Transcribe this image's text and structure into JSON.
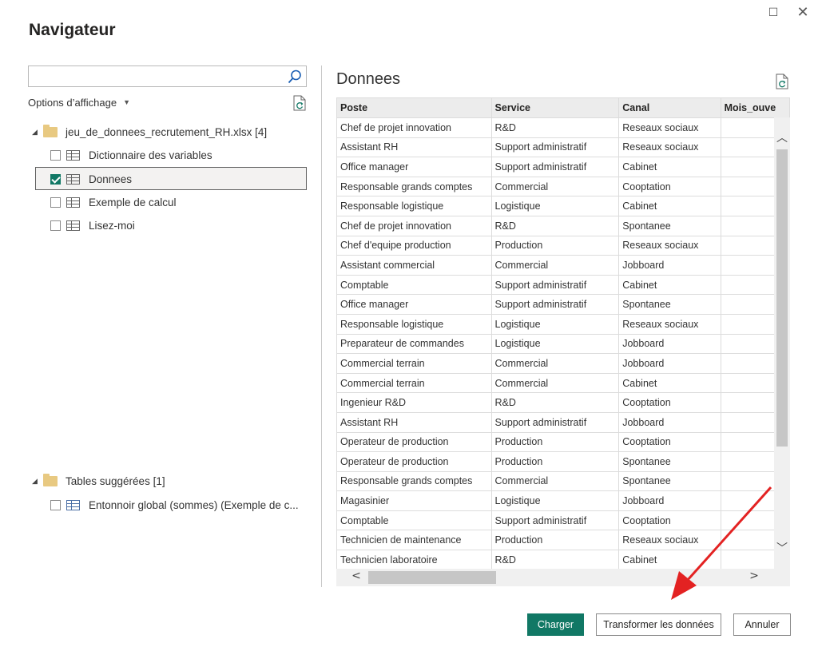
{
  "window": {
    "title": "Navigateur",
    "maximize_glyph": "☐",
    "close_glyph": "✕"
  },
  "left": {
    "search": {
      "value": "",
      "placeholder": "",
      "icon": "search-icon"
    },
    "options_label": "Options d’affichage",
    "file": {
      "name": "jeu_de_donnees_recrutement_RH.xlsx [4]"
    },
    "items": [
      {
        "label": "Dictionnaire des variables",
        "checked": false
      },
      {
        "label": "Donnees",
        "checked": true
      },
      {
        "label": "Exemple de calcul",
        "checked": false
      },
      {
        "label": "Lisez-moi",
        "checked": false
      }
    ],
    "suggested": {
      "label": "Tables suggérées [1]",
      "items": [
        {
          "label": "Entonnoir global (sommes) (Exemple de c...",
          "checked": false
        }
      ]
    }
  },
  "preview": {
    "title": "Donnees",
    "columns": [
      "Poste",
      "Service",
      "Canal",
      "Mois_ouve"
    ],
    "rows": [
      [
        "Chef de projet innovation",
        "R&D",
        "Reseaux sociaux",
        ""
      ],
      [
        "Assistant RH",
        "Support administratif",
        "Reseaux sociaux",
        ""
      ],
      [
        "Office manager",
        "Support administratif",
        "Cabinet",
        ""
      ],
      [
        "Responsable grands comptes",
        "Commercial",
        "Cooptation",
        ""
      ],
      [
        "Responsable logistique",
        "Logistique",
        "Cabinet",
        ""
      ],
      [
        "Chef de projet innovation",
        "R&D",
        "Spontanee",
        ""
      ],
      [
        "Chef d'equipe production",
        "Production",
        "Reseaux sociaux",
        ""
      ],
      [
        "Assistant commercial",
        "Commercial",
        "Jobboard",
        ""
      ],
      [
        "Comptable",
        "Support administratif",
        "Cabinet",
        ""
      ],
      [
        "Office manager",
        "Support administratif",
        "Spontanee",
        ""
      ],
      [
        "Responsable logistique",
        "Logistique",
        "Reseaux sociaux",
        ""
      ],
      [
        "Preparateur de commandes",
        "Logistique",
        "Jobboard",
        ""
      ],
      [
        "Commercial terrain",
        "Commercial",
        "Jobboard",
        ""
      ],
      [
        "Commercial terrain",
        "Commercial",
        "Cabinet",
        ""
      ],
      [
        "Ingenieur R&D",
        "R&D",
        "Cooptation",
        ""
      ],
      [
        "Assistant RH",
        "Support administratif",
        "Jobboard",
        ""
      ],
      [
        "Operateur de production",
        "Production",
        "Cooptation",
        ""
      ],
      [
        "Operateur de production",
        "Production",
        "Spontanee",
        ""
      ],
      [
        "Responsable grands comptes",
        "Commercial",
        "Spontanee",
        ""
      ],
      [
        "Magasinier",
        "Logistique",
        "Jobboard",
        ""
      ],
      [
        "Comptable",
        "Support administratif",
        "Cooptation",
        ""
      ],
      [
        "Technicien de maintenance",
        "Production",
        "Reseaux sociaux",
        ""
      ],
      [
        "Technicien laboratoire",
        "R&D",
        "Cabinet",
        ""
      ]
    ]
  },
  "buttons": {
    "load": "Charger",
    "transform": "Transformer les données",
    "cancel": "Annuler"
  },
  "colors": {
    "accent": "#117865",
    "annotation_arrow": "#e32222"
  }
}
